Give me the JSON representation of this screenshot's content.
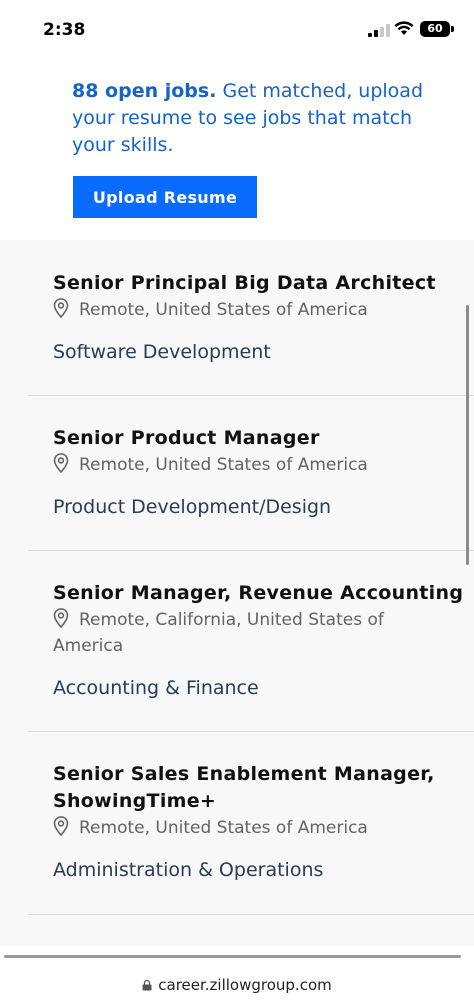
{
  "status": {
    "time": "2:38",
    "battery": "60"
  },
  "intro": {
    "count": "88 open jobs.",
    "text": " Get matched, upload your resume to see jobs that match your skills.",
    "button": "Upload Resume"
  },
  "jobs": [
    {
      "title": "Senior Principal Big Data Architect",
      "location": "Remote, United States of America",
      "category": "Software Development"
    },
    {
      "title": "Senior Product Manager",
      "location": "Remote, United States of America",
      "category": "Product Development/Design"
    },
    {
      "title": "Senior Manager, Revenue Accounting",
      "location_line1": "Remote, California, United States of",
      "location_line2": "America",
      "category": "Accounting & Finance"
    },
    {
      "title_line1": "Senior Sales Enablement Manager,",
      "title_line2": "ShowingTime+",
      "location": "Remote, United States of America",
      "category": "Administration & Operations"
    }
  ],
  "browser": {
    "url": "career.zillowgroup.com"
  },
  "icons": {
    "location": "location-pin-icon",
    "lock": "lock-icon"
  }
}
